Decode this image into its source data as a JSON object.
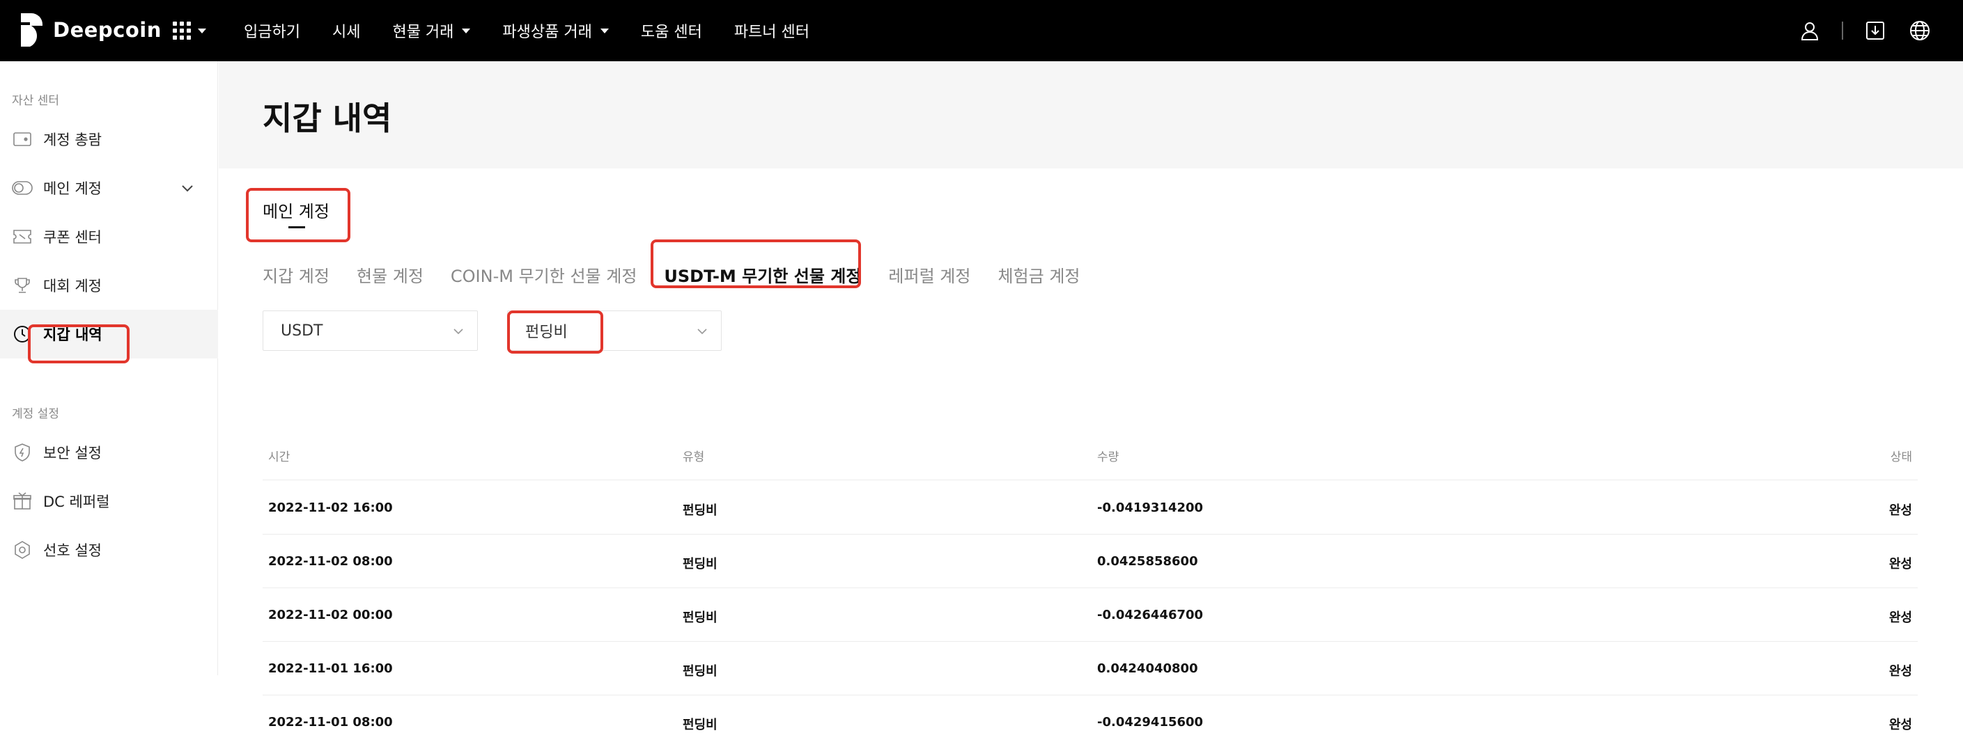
{
  "brand": {
    "name": "Deepcoin"
  },
  "topnav": {
    "items": [
      {
        "label": "입금하기",
        "caret": false
      },
      {
        "label": "시세",
        "caret": false
      },
      {
        "label": "현물 거래",
        "caret": true
      },
      {
        "label": "파생상품 거래",
        "caret": true
      },
      {
        "label": "도움 센터",
        "caret": false
      },
      {
        "label": "파트너 센터",
        "caret": false
      }
    ],
    "right_icons": [
      "user-icon",
      "download-icon",
      "globe-icon"
    ]
  },
  "sidebar": {
    "section1": "자산 센터",
    "section2": "계정 설정",
    "items": [
      {
        "label": "계정 총람",
        "icon": "wallet-icon"
      },
      {
        "label": "메인 계정",
        "icon": "toggle-icon"
      },
      {
        "label": "쿠폰 센터",
        "icon": "ticket-icon"
      },
      {
        "label": "대회 계정",
        "icon": "trophy-icon"
      },
      {
        "label": "지갑 내역",
        "icon": "clock-icon"
      },
      {
        "label": "보안 설정",
        "icon": "shield-icon"
      },
      {
        "label": "DC 레퍼럴",
        "icon": "gift-icon"
      },
      {
        "label": "선호 설정",
        "icon": "settings-icon"
      }
    ]
  },
  "page": {
    "title": "지갑 내역",
    "account_tab": "메인 계정",
    "subtabs": [
      "지갑 계정",
      "현물 계정",
      "COIN-M 무기한 선물 계정",
      "USDT-M 무기한 선물 계정",
      "레퍼럴 계정",
      "체험금 계정"
    ],
    "active_subtab": "USDT-M 무기한 선물 계정",
    "filters": {
      "currency": "USDT",
      "type": "펀딩비"
    }
  },
  "table": {
    "headers": [
      "시간",
      "유형",
      "수량",
      "상태"
    ],
    "rows": [
      [
        "2022-11-02 16:00",
        "펀딩비",
        "-0.0419314200",
        "완성"
      ],
      [
        "2022-11-02 08:00",
        "펀딩비",
        "0.0425858600",
        "완성"
      ],
      [
        "2022-11-02 00:00",
        "펀딩비",
        "-0.0426446700",
        "완성"
      ],
      [
        "2022-11-01 16:00",
        "펀딩비",
        "0.0424040800",
        "완성"
      ],
      [
        "2022-11-01 08:00",
        "펀딩비",
        "-0.0429415600",
        "완성"
      ]
    ]
  },
  "colors": {
    "topbar": "#000000",
    "highlight": "#e2362c",
    "title_band": "#f6f6f6"
  }
}
